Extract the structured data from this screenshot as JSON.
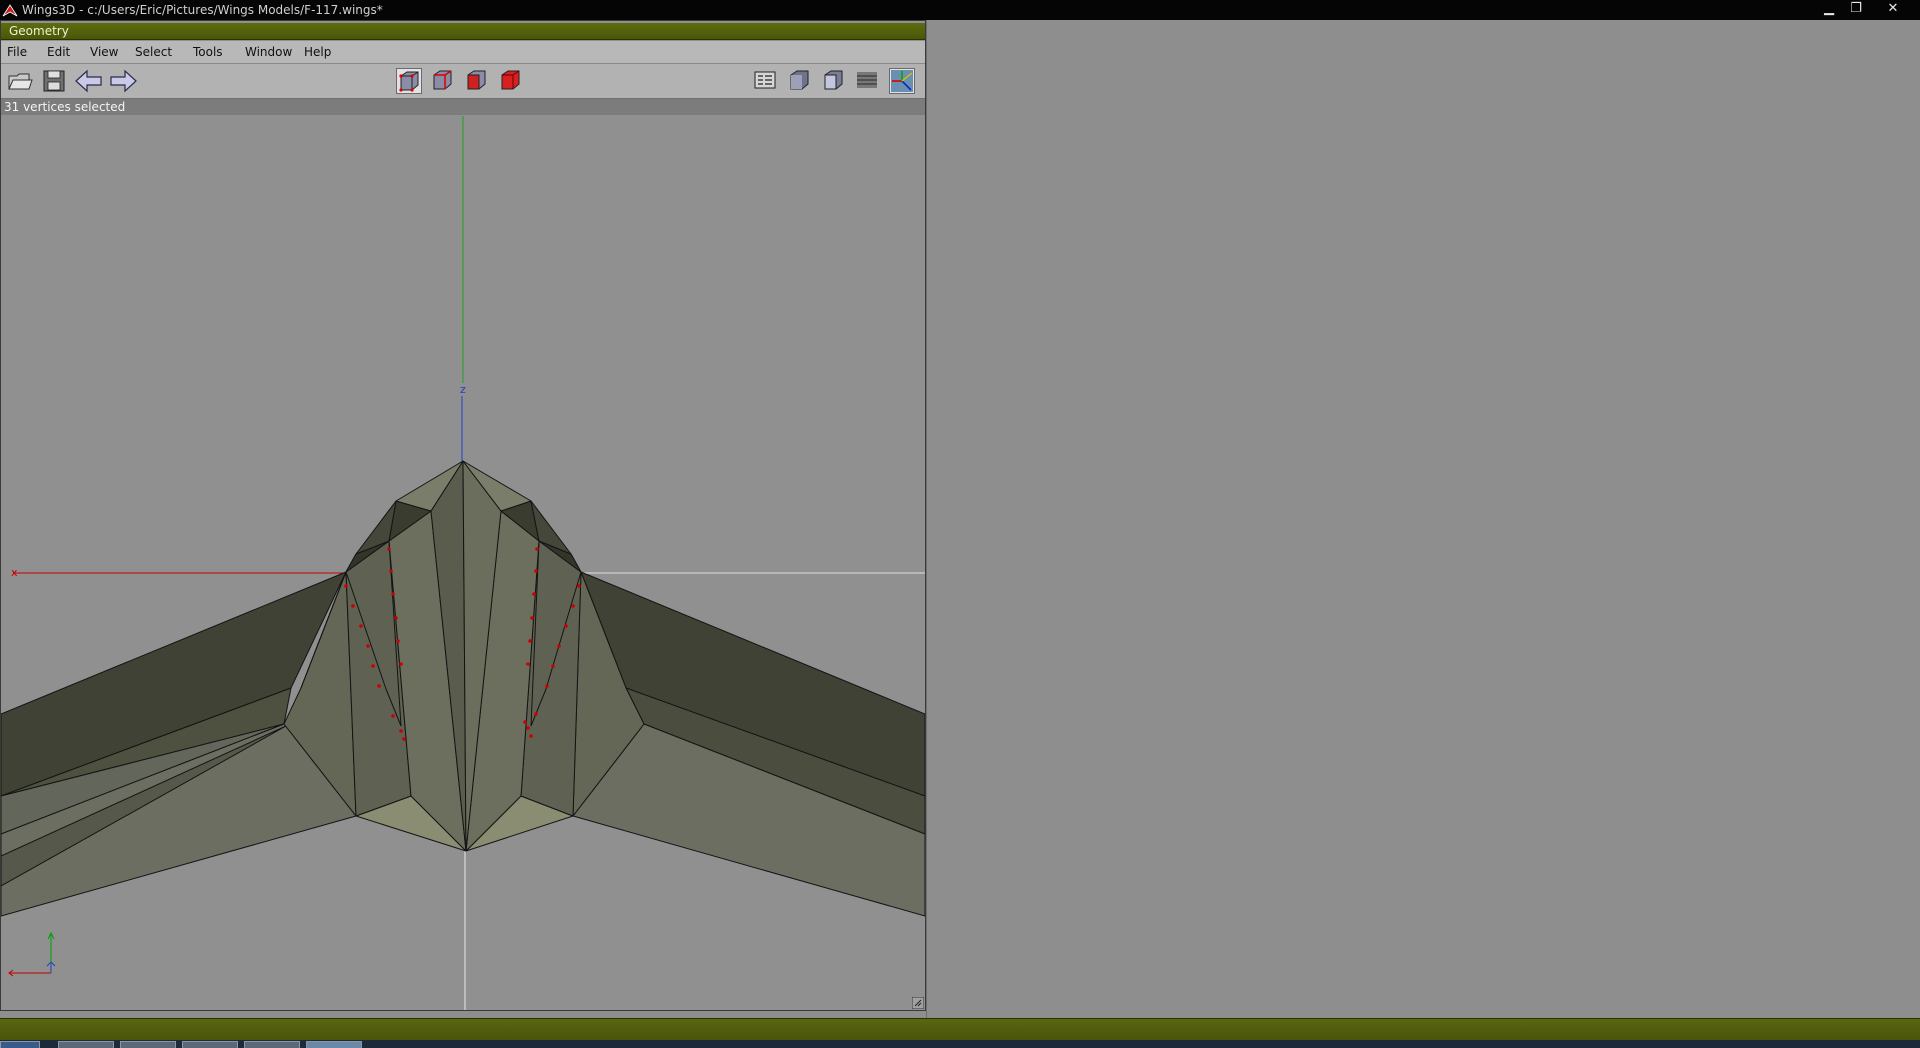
{
  "window": {
    "title": "Wings3D - c:/Users/Eric/Pictures/Wings Models/F-117.wings*",
    "minimize_glyph": "▁",
    "restore_glyph": "❐",
    "close_glyph": "✕"
  },
  "geometry": {
    "title": "Geometry",
    "menus": [
      "File",
      "Edit",
      "View",
      "Select",
      "Tools",
      "Window",
      "Help"
    ],
    "status": "31 vertices selected",
    "axis_labels": {
      "x": "x",
      "z": "z"
    }
  },
  "toolbar": {
    "icons": [
      "open-icon",
      "save-icon",
      "undo-icon",
      "redo-icon",
      "vertex-mode-icon",
      "edge-mode-icon",
      "face-mode-icon",
      "body-mode-icon",
      "groundplane-icon",
      "smooth-shade-icon",
      "flat-shade-icon",
      "wireframe-icon",
      "axes-icon"
    ]
  },
  "colors": {
    "title_green": "#5e6c10",
    "x_axis": "#cc0000",
    "y_axis": "#00aa00",
    "z_axis": "#0033cc",
    "selected_vertex": "#cc0000",
    "mesh_face": "#5f6253"
  }
}
